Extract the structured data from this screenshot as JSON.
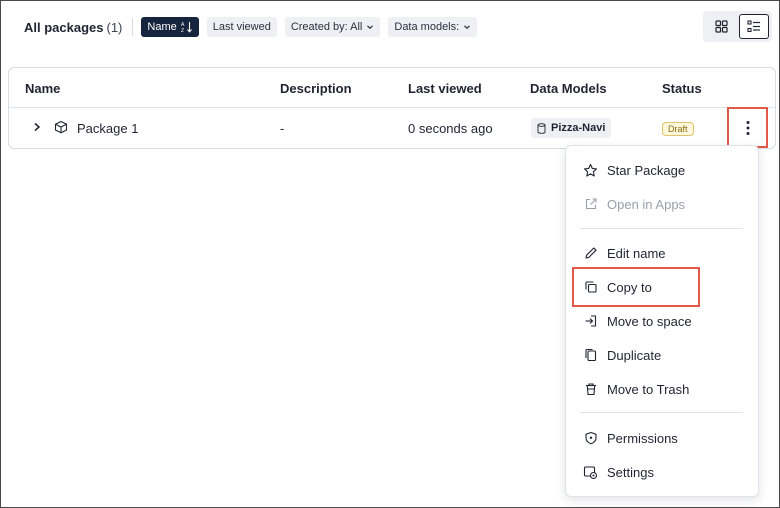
{
  "header": {
    "title": "All packages",
    "count": "(1)",
    "sort_chip": "Name",
    "last_viewed_chip": "Last viewed",
    "created_by_chip": "Created by: All",
    "data_models_chip": "Data models:"
  },
  "view_toggle": {
    "grid_icon": "grid-icon",
    "list_icon": "list-icon",
    "active": "list"
  },
  "table": {
    "columns": [
      "Name",
      "Description",
      "Last viewed",
      "Data Models",
      "Status"
    ],
    "rows": [
      {
        "name": "Package 1",
        "description": "-",
        "last_viewed": "0 seconds ago",
        "data_model": "Pizza-Navi",
        "status": "Draft"
      }
    ]
  },
  "menu": {
    "items": [
      {
        "label": "Star Package",
        "icon": "star-icon",
        "disabled": false
      },
      {
        "label": "Open in Apps",
        "icon": "external-link-icon",
        "disabled": true
      },
      {
        "label": "Edit name",
        "icon": "pencil-icon",
        "disabled": false
      },
      {
        "label": "Copy to",
        "icon": "copy-icon",
        "disabled": false
      },
      {
        "label": "Move to space",
        "icon": "move-icon",
        "disabled": false
      },
      {
        "label": "Duplicate",
        "icon": "duplicate-icon",
        "disabled": false
      },
      {
        "label": "Move to Trash",
        "icon": "trash-icon",
        "disabled": false
      },
      {
        "label": "Permissions",
        "icon": "shield-icon",
        "disabled": false
      },
      {
        "label": "Settings",
        "icon": "settings-icon",
        "disabled": false
      }
    ]
  },
  "colors": {
    "accent_dark": "#17243d",
    "highlight": "#e05a47",
    "draft_border": "#e0c36a"
  }
}
